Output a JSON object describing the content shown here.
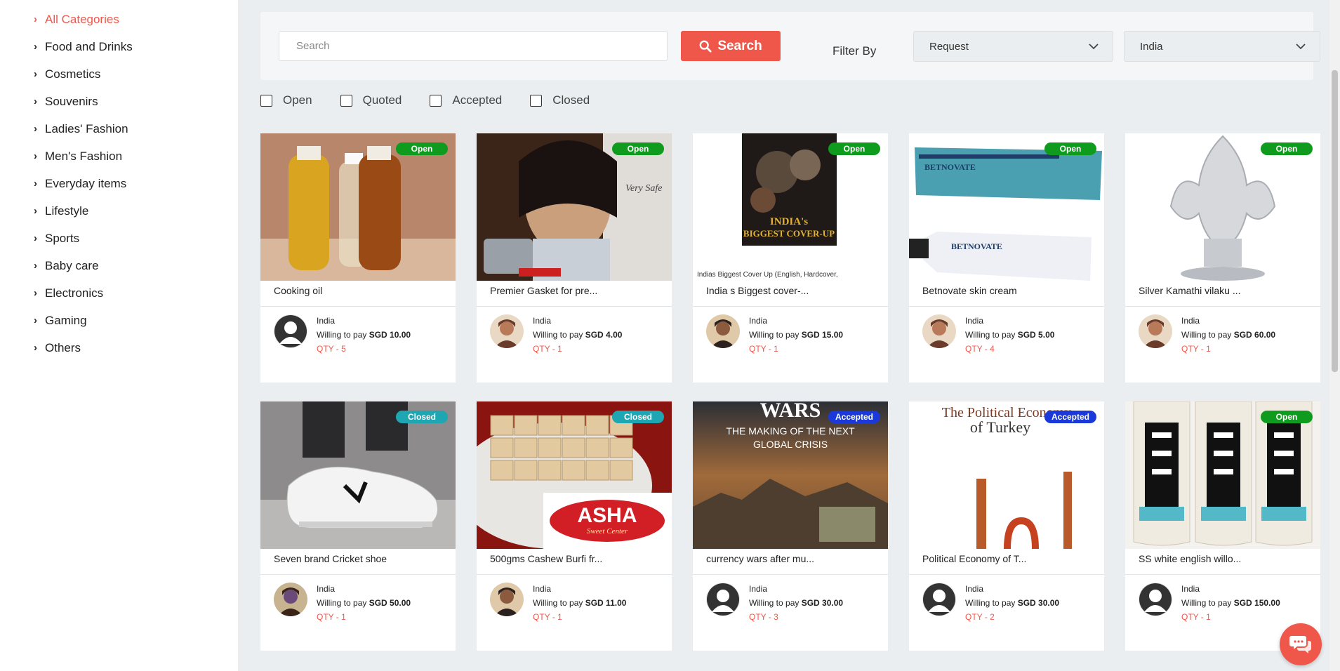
{
  "sidebar": {
    "items": [
      {
        "label": "All Categories",
        "active": true
      },
      {
        "label": "Food and Drinks"
      },
      {
        "label": "Cosmetics"
      },
      {
        "label": "Souvenirs"
      },
      {
        "label": "Ladies' Fashion"
      },
      {
        "label": "Men's Fashion"
      },
      {
        "label": "Everyday items"
      },
      {
        "label": "Lifestyle"
      },
      {
        "label": "Sports"
      },
      {
        "label": "Baby care"
      },
      {
        "label": "Electronics"
      },
      {
        "label": "Gaming"
      },
      {
        "label": "Others"
      }
    ]
  },
  "search": {
    "placeholder": "Search",
    "button_label": "Search",
    "filter_label": "Filter By",
    "type_select": "Request",
    "country_select": "India"
  },
  "status_filters": [
    "Open",
    "Quoted",
    "Accepted",
    "Closed"
  ],
  "cards": [
    {
      "title": "Cooking oil",
      "status": "Open",
      "country": "India",
      "pay_prefix": "Willing to pay",
      "price": "SGD 10.00",
      "qty": "QTY - 5",
      "image": "oil-bottles",
      "avatar": "default"
    },
    {
      "title": "Premier Gasket for pre...",
      "status": "Open",
      "country": "India",
      "pay_prefix": "Willing to pay",
      "price": "SGD 4.00",
      "qty": "QTY - 1",
      "image": "premier-ad",
      "avatar": "photo-a",
      "image_text": "Very Safe"
    },
    {
      "title": "India s Biggest cover-...",
      "status": "Open",
      "country": "India",
      "pay_prefix": "Willing to pay",
      "price": "SGD 15.00",
      "qty": "QTY - 1",
      "image": "book-cover",
      "avatar": "photo-b",
      "image_text": "INDIA's BIGGEST COVER-UP",
      "image_caption": "Indias Biggest Cover Up (English, Hardcover,"
    },
    {
      "title": "Betnovate skin cream",
      "status": "Open",
      "country": "India",
      "pay_prefix": "Willing to pay",
      "price": "SGD 5.00",
      "qty": "QTY - 4",
      "image": "cream-tube",
      "avatar": "photo-a",
      "image_text": "BETNOVATE"
    },
    {
      "title": "Silver Kamathi vilaku ...",
      "status": "Open",
      "country": "India",
      "pay_prefix": "Willing to pay",
      "price": "SGD 60.00",
      "qty": "QTY - 1",
      "image": "silver-lamp",
      "avatar": "photo-a"
    },
    {
      "title": "Seven brand Cricket shoe",
      "status": "Closed",
      "country": "India",
      "pay_prefix": "Willing to pay",
      "price": "SGD 50.00",
      "qty": "QTY - 1",
      "image": "white-shoe",
      "avatar": "photo-c"
    },
    {
      "title": "500gms Cashew Burfi fr...",
      "status": "Closed",
      "country": "India",
      "pay_prefix": "Willing to pay",
      "price": "SGD 11.00",
      "qty": "QTY - 1",
      "image": "burfi",
      "avatar": "photo-b",
      "image_text": "ASHA",
      "image_subtext": "Sweet Center"
    },
    {
      "title": "currency wars after mu...",
      "status": "Accepted",
      "country": "India",
      "pay_prefix": "Willing to pay",
      "price": "SGD 30.00",
      "qty": "QTY - 3",
      "image": "currency-wars",
      "avatar": "default",
      "image_text": "WARS",
      "image_subtext": "THE MAKING OF THE NEXT GLOBAL CRISIS"
    },
    {
      "title": "Political Economy of T...",
      "status": "Accepted",
      "country": "India",
      "pay_prefix": "Willing to pay",
      "price": "SGD 30.00",
      "qty": "QTY - 2",
      "image": "turkey-book",
      "avatar": "default",
      "image_text": "The Political Economy of Turkey"
    },
    {
      "title": "SS white english willo...",
      "status": "Open",
      "country": "India",
      "pay_prefix": "Willing to pay",
      "price": "SGD 150.00",
      "qty": "QTY - 1",
      "image": "cricket-bats",
      "avatar": "default"
    }
  ]
}
